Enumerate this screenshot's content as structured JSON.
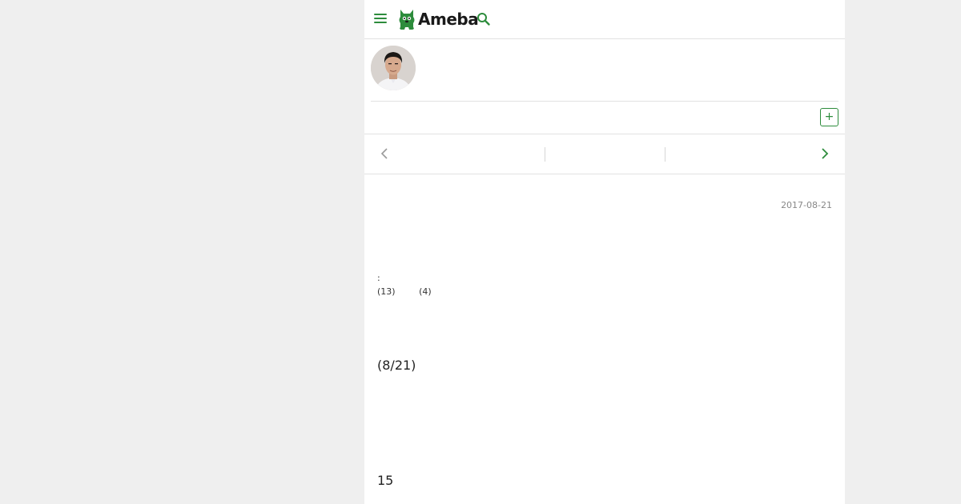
{
  "header": {
    "logo_text": "Ameba",
    "brand_color": "#2d8c3c",
    "menu_icon": "hamburger-menu-icon",
    "search_icon": "search-icon"
  },
  "profile": {
    "avatar_icon": "user-avatar"
  },
  "follow": {
    "label": "+"
  },
  "nav": {
    "prev_icon": "chevron-left-icon",
    "next_icon": "chevron-right-icon"
  },
  "article": {
    "date": "2017-08-21",
    "theme_separator": ":",
    "like_count": "(13)",
    "comment_count": "(4)",
    "heading_date": "(8/21)",
    "heading_number": "15"
  }
}
